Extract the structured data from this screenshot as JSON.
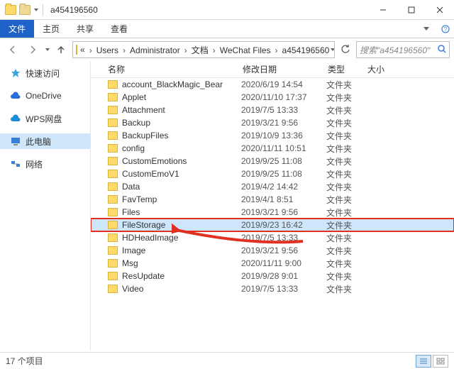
{
  "window": {
    "title": "a454196560",
    "minimize": "—",
    "maximize": "□",
    "close": "×"
  },
  "menu": {
    "file": "文件",
    "home": "主页",
    "share": "共享",
    "view": "查看"
  },
  "breadcrumb": {
    "prefix": "«",
    "items": [
      "Users",
      "Administrator",
      "文档",
      "WeChat Files",
      "a454196560"
    ]
  },
  "search": {
    "placeholder": "搜索\"a454196560\""
  },
  "sidebar": {
    "items": [
      {
        "label": "快速访问",
        "icon": "star"
      },
      {
        "label": "OneDrive",
        "icon": "cloud"
      },
      {
        "label": "WPS网盘",
        "icon": "wps"
      },
      {
        "label": "此电脑",
        "icon": "pc",
        "selected": true
      },
      {
        "label": "网络",
        "icon": "net"
      }
    ]
  },
  "columns": {
    "name": "名称",
    "date": "修改日期",
    "type": "类型",
    "size": "大小"
  },
  "type_folder": "文件夹",
  "files": [
    {
      "name": "account_BlackMagic_Bear",
      "date": "2020/6/19 14:54"
    },
    {
      "name": "Applet",
      "date": "2020/11/10 17:37"
    },
    {
      "name": "Attachment",
      "date": "2019/7/5 13:33"
    },
    {
      "name": "Backup",
      "date": "2019/3/21 9:56"
    },
    {
      "name": "BackupFiles",
      "date": "2019/10/9 13:36"
    },
    {
      "name": "config",
      "date": "2020/11/11 10:51"
    },
    {
      "name": "CustomEmotions",
      "date": "2019/9/25 11:08"
    },
    {
      "name": "CustomEmoV1",
      "date": "2019/9/25 11:08"
    },
    {
      "name": "Data",
      "date": "2019/4/2 14:42"
    },
    {
      "name": "FavTemp",
      "date": "2019/4/1 8:51"
    },
    {
      "name": "Files",
      "date": "2019/3/21 9:56"
    },
    {
      "name": "FileStorage",
      "date": "2019/9/23 16:42",
      "selected": true,
      "highlight": true
    },
    {
      "name": "HDHeadImage",
      "date": "2019/7/5 13:33"
    },
    {
      "name": "Image",
      "date": "2019/3/21 9:56"
    },
    {
      "name": "Msg",
      "date": "2020/11/11 9:00"
    },
    {
      "name": "ResUpdate",
      "date": "2019/9/28 9:01"
    },
    {
      "name": "Video",
      "date": "2019/7/5 13:33"
    }
  ],
  "status": {
    "count_text": "17 个项目"
  },
  "annotation": {
    "arrow_color": "#e03020"
  }
}
